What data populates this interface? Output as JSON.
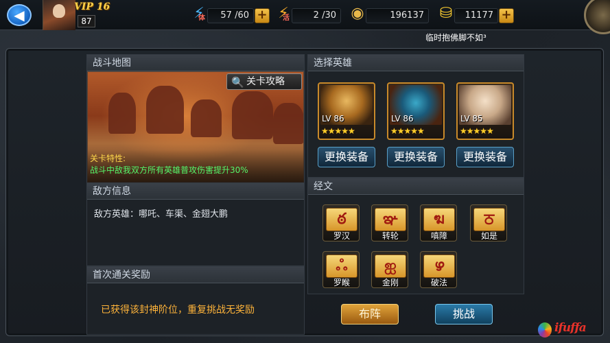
{
  "top_bar": {
    "vip_label": "VIP 16",
    "player_level": "87",
    "stamina": {
      "label": "体",
      "value": "57 /60"
    },
    "vitality": {
      "label": "活",
      "value": "2 /30"
    },
    "coins": {
      "value": "196137"
    },
    "ingots": {
      "value": "11177"
    },
    "plus_symbol": "+"
  },
  "marquee_text": "临时抱佛脚不如³",
  "battle_map": {
    "title": "战斗地图",
    "guide_button": "关卡攻略",
    "feature_title": "关卡特性:",
    "feature_desc": "战斗中敌我双方所有英雄普攻伤害提升30%"
  },
  "enemy_info": {
    "title": "敌方信息",
    "text": "敌方英雄：哪吒、车渠、金翅大鹏"
  },
  "first_clear_reward": {
    "title": "首次通关奖励",
    "text": "已获得该封神阶位，重复挑战无奖励"
  },
  "select_heroes": {
    "title": "选择英雄",
    "heroes": [
      {
        "level": "LV 86",
        "stars": "★★★★★",
        "equip_button": "更换装备"
      },
      {
        "level": "LV 86",
        "stars": "★★★★★",
        "equip_button": "更换装备"
      },
      {
        "level": "LV 85",
        "stars": "★★★★★",
        "equip_button": "更换装备"
      }
    ]
  },
  "scriptures": {
    "title": "经文",
    "items": [
      {
        "glyph": "ఠ",
        "label": "罗汉"
      },
      {
        "glyph": "ఞ",
        "label": "转轮"
      },
      {
        "glyph": "ฆ",
        "label": "嗔障"
      },
      {
        "glyph": "ਠ",
        "label": "如是"
      },
      {
        "glyph": "ஃ",
        "label": "罗睺"
      },
      {
        "glyph": "ஐ",
        "label": "金刚"
      },
      {
        "glyph": "ഴ",
        "label": "破法"
      }
    ]
  },
  "actions": {
    "formation": "布阵",
    "challenge": "挑战"
  },
  "watermark": {
    "text": "ifuffa"
  }
}
